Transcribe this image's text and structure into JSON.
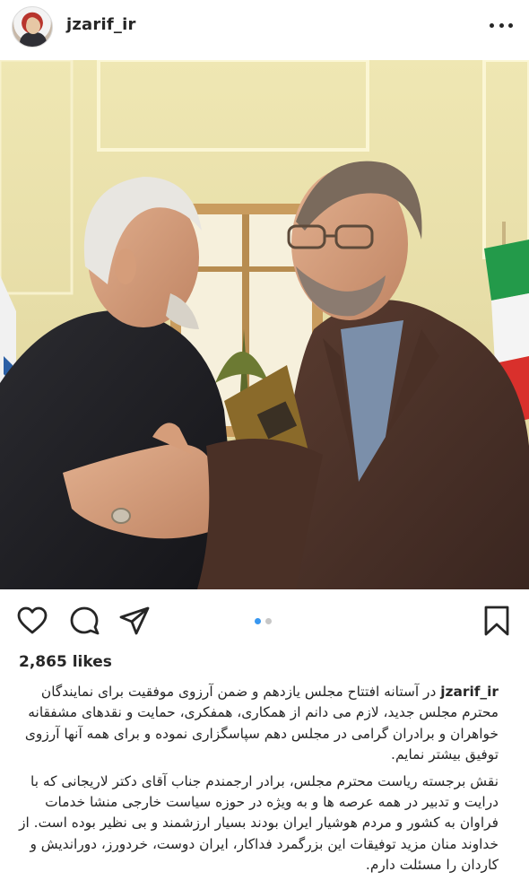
{
  "header": {
    "username": "jzarif_ir"
  },
  "post": {
    "likes": "2,865 likes",
    "carousel": {
      "count": 2,
      "active": 1
    }
  },
  "caption": {
    "username": "jzarif_ir",
    "paragraph1": "در آستانه افتتاح مجلس یازدهم و ضمن آرزوی موفقیت برای نمایندگان محترم مجلس جدید، لازم می دانم از همکاری، همفکری، حمایت و نقدهای مشفقانه خواهران و برادران گرامی در مجلس دهم سپاسگزاری نموده و برای همه آنها آرزوی توفیق بیشتر نمایم.",
    "paragraph2": "نقش برجسته ریاست محترم مجلس، برادر ارجمندم جناب آقای دکتر لاریجانی که با درایت و تدبیر در همه عرصه ها و به ویژه در حوزه سیاست خارجی منشا خدمات فراوان به کشور و مردم هوشیار ایران بودند بسیار ارزشمند و بی نظیر بوده است. از خداوند منان مزید توفیقات این بزرگمرد فداکار، ایران دوست، خردورز، دوراندیش و کاردان را مسئلت دارم."
  },
  "colors": {
    "text": "#262626",
    "carousel_active": "#3897f0",
    "carousel_inactive": "#c7c7c7"
  },
  "icons": [
    "more-icon",
    "heart-icon",
    "comment-icon",
    "share-icon",
    "bookmark-icon"
  ]
}
